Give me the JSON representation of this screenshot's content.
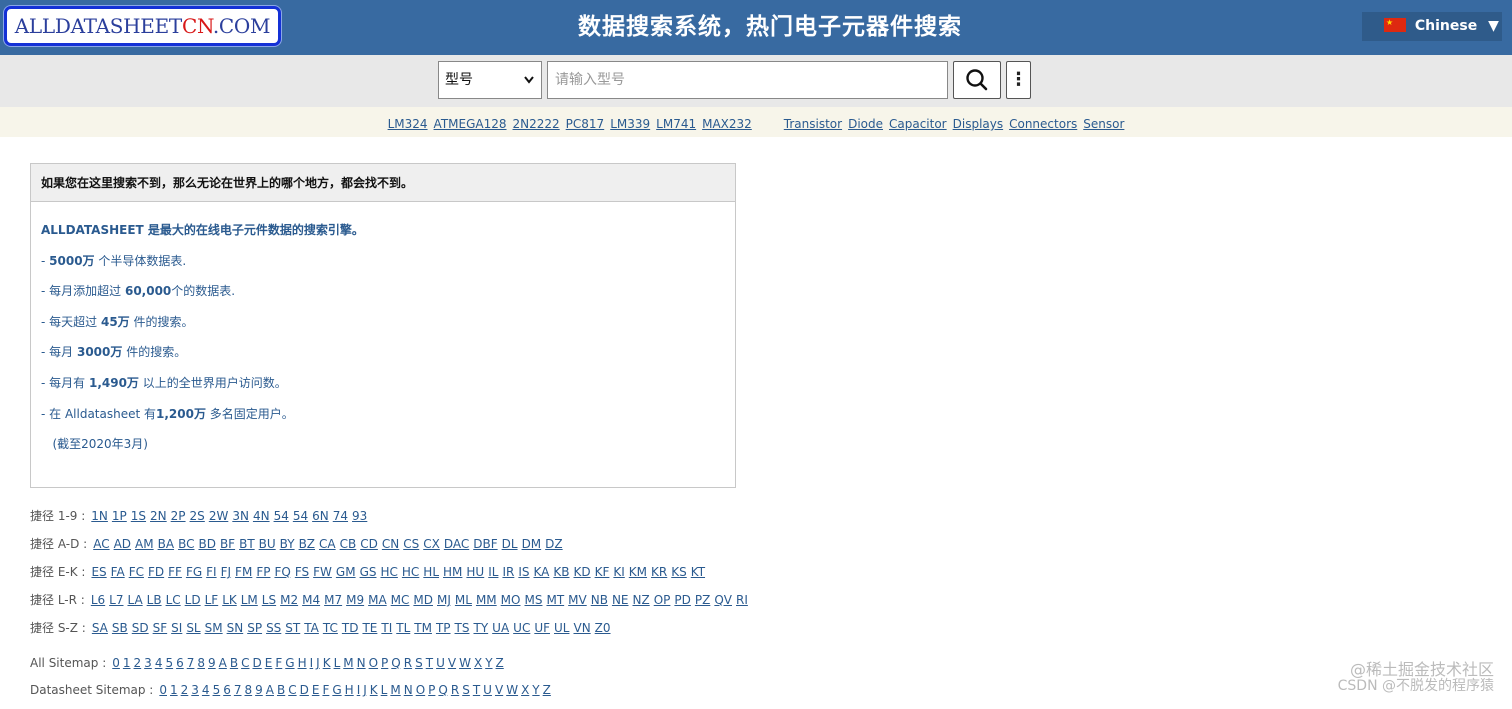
{
  "header": {
    "logo_main": "ALLDATASHEET",
    "logo_cn": "CN",
    "logo_tld": ".COM",
    "title": "数据搜索系统，热门电子元器件搜索",
    "language": "Chinese",
    "language_arrow": "▼"
  },
  "search": {
    "select_value": "型号",
    "placeholder": "请输入型号",
    "more_label": "⋮"
  },
  "quick_links": {
    "parts": [
      "LM324",
      "ATMEGA128",
      "2N2222",
      "PC817",
      "LM339",
      "LM741",
      "MAX232"
    ],
    "categories": [
      "Transistor",
      "Diode",
      "Capacitor",
      "Displays",
      "Connectors",
      "Sensor"
    ]
  },
  "info": {
    "heading": "如果您在这里搜索不到，那么无论在世界上的哪个地方，都会找不到。",
    "lead": "ALLDATASHEET 是最大的在线电子元件数据的搜索引擎。",
    "lines": [
      {
        "pre": " - ",
        "bold": "5000万",
        "post": " 个半导体数据表."
      },
      {
        "pre": " - 每月添加超过 ",
        "bold": "60,000",
        "post": "个的数据表."
      },
      {
        "pre": " - 每天超过 ",
        "bold": "45万",
        "post": " 件的搜索。"
      },
      {
        "pre": " - 每月 ",
        "bold": "3000万",
        "post": " 件的搜索。"
      },
      {
        "pre": " - 每月有 ",
        "bold": "1,490万",
        "post": " 以上的全世界用户访问数。"
      },
      {
        "pre": " - 在 Alldatasheet 有",
        "bold": "1,200万",
        "post": " 多名固定用户。"
      }
    ],
    "note": "(截至2020年3月)"
  },
  "shortcuts": [
    {
      "label": "捷径 1-9 :",
      "links": [
        "1N",
        "1P",
        "1S",
        "2N",
        "2P",
        "2S",
        "2W",
        "3N",
        "4N",
        "54",
        "54",
        "6N",
        "74",
        "93"
      ]
    },
    {
      "label": "捷径 A-D :",
      "links": [
        "AC",
        "AD",
        "AM",
        "BA",
        "BC",
        "BD",
        "BF",
        "BT",
        "BU",
        "BY",
        "BZ",
        "CA",
        "CB",
        "CD",
        "CN",
        "CS",
        "CX",
        "DAC",
        "DBF",
        "DL",
        "DM",
        "DZ"
      ]
    },
    {
      "label": "捷径 E-K :",
      "links": [
        "ES",
        "FA",
        "FC",
        "FD",
        "FF",
        "FG",
        "FI",
        "FJ",
        "FM",
        "FP",
        "FQ",
        "FS",
        "FW",
        "GM",
        "GS",
        "HC",
        "HC",
        "HL",
        "HM",
        "HU",
        "IL",
        "IR",
        "IS",
        "KA",
        "KB",
        "KD",
        "KF",
        "KI",
        "KM",
        "KR",
        "KS",
        "KT"
      ]
    },
    {
      "label": "捷径 L-R :",
      "links": [
        "L6",
        "L7",
        "LA",
        "LB",
        "LC",
        "LD",
        "LF",
        "LK",
        "LM",
        "LS",
        "M2",
        "M4",
        "M7",
        "M9",
        "MA",
        "MC",
        "MD",
        "MJ",
        "ML",
        "MM",
        "MO",
        "MS",
        "MT",
        "MV",
        "NB",
        "NE",
        "NZ",
        "OP",
        "PD",
        "PZ",
        "QV",
        "RI"
      ]
    },
    {
      "label": "捷径 S-Z :",
      "links": [
        "SA",
        "SB",
        "SD",
        "SF",
        "SI",
        "SL",
        "SM",
        "SN",
        "SP",
        "SS",
        "ST",
        "TA",
        "TC",
        "TD",
        "TE",
        "TI",
        "TL",
        "TM",
        "TP",
        "TS",
        "TY",
        "UA",
        "UC",
        "UF",
        "UL",
        "VN",
        "Z0"
      ]
    }
  ],
  "sitemaps": [
    {
      "label": "All Sitemap :",
      "links": [
        "0",
        "1",
        "2",
        "3",
        "4",
        "5",
        "6",
        "7",
        "8",
        "9",
        "A",
        "B",
        "C",
        "D",
        "E",
        "F",
        "G",
        "H",
        "I",
        "J",
        "K",
        "L",
        "M",
        "N",
        "O",
        "P",
        "Q",
        "R",
        "S",
        "T",
        "U",
        "V",
        "W",
        "X",
        "Y",
        "Z"
      ]
    },
    {
      "label": "Datasheet Sitemap :",
      "links": [
        "0",
        "1",
        "2",
        "3",
        "4",
        "5",
        "6",
        "7",
        "8",
        "9",
        "A",
        "B",
        "C",
        "D",
        "E",
        "F",
        "G",
        "H",
        "I",
        "J",
        "K",
        "L",
        "M",
        "N",
        "O",
        "P",
        "Q",
        "R",
        "S",
        "T",
        "U",
        "V",
        "W",
        "X",
        "Y",
        "Z"
      ]
    }
  ],
  "watermark": {
    "line1": "@稀土掘金技术社区",
    "line2": "CSDN @不脱发的程序猿"
  },
  "colors": {
    "header_bg": "#386aa1",
    "link": "#2a5a8f",
    "logo_border": "#1431d6",
    "logo_cn": "#d81818"
  }
}
